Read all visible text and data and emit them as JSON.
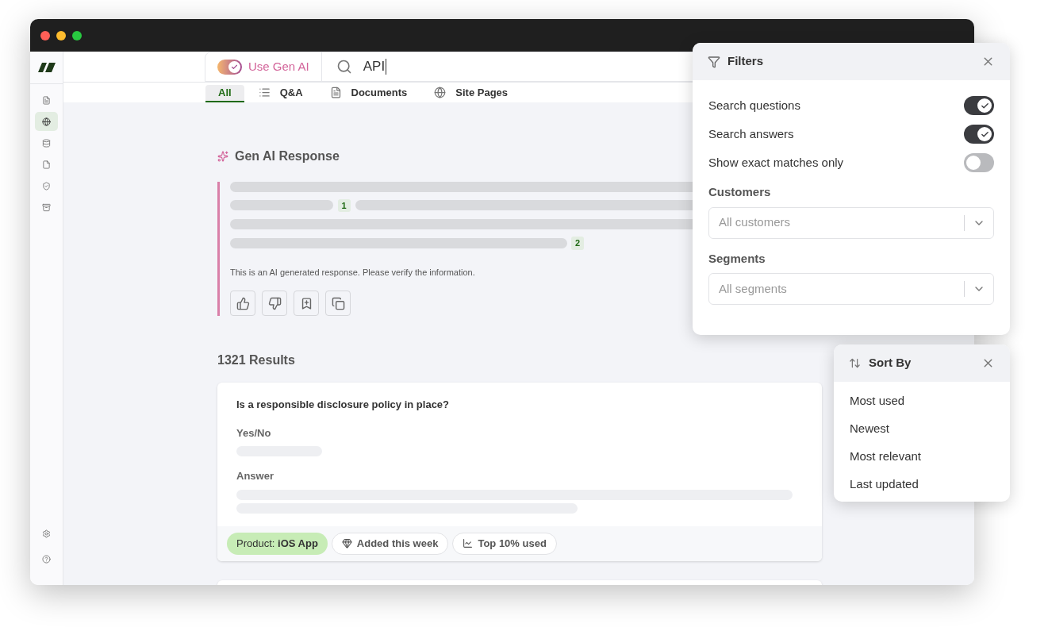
{
  "sidebar": {
    "items": [
      {
        "selected": false
      },
      {
        "selected": true
      },
      {
        "selected": false
      },
      {
        "selected": false
      },
      {
        "selected": false
      },
      {
        "selected": false
      }
    ],
    "bottom_items": [
      {
        "kind": "settings"
      },
      {
        "kind": "help"
      }
    ]
  },
  "search": {
    "gen_ai_toggle": {
      "label": "Use Gen AI",
      "on": true
    },
    "query": "API"
  },
  "tabs": [
    {
      "label": "All",
      "selected": true
    },
    {
      "label": "Q&A",
      "selected": false
    },
    {
      "label": "Documents",
      "selected": false
    },
    {
      "label": "Site Pages",
      "selected": false
    }
  ],
  "gen_ai_response": {
    "title": "Gen AI Response",
    "citations": [
      "1",
      "2"
    ],
    "disclaimer": "This is an AI generated response. Please verify the information."
  },
  "results_count": "1321 Results",
  "results": [
    {
      "question": "Is a responsible disclosure policy in place?",
      "fields": [
        "Yes/No",
        "Answer"
      ],
      "tags": [
        {
          "kind": "product",
          "label": "Product: **iOS App**"
        },
        {
          "kind": "new",
          "label": "Added this week"
        },
        {
          "kind": "usage",
          "label": "Top 10% used"
        }
      ]
    }
  ],
  "filters": {
    "title": "Filters",
    "toggles": [
      {
        "label": "Search questions",
        "on": true
      },
      {
        "label": "Search answers",
        "on": true
      },
      {
        "label": "Show exact matches only",
        "on": false
      }
    ],
    "dropdowns": [
      {
        "label": "Customers",
        "placeholder": "All customers"
      },
      {
        "label": "Segments",
        "placeholder": "All segments"
      }
    ]
  },
  "sort": {
    "title": "Sort By",
    "options": [
      "Most used",
      "Newest",
      "Most relevant",
      "Last updated"
    ]
  }
}
